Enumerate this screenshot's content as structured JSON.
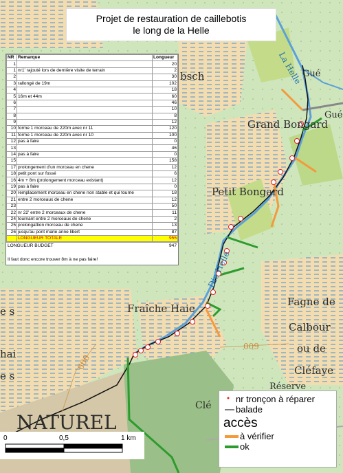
{
  "title": {
    "line1": "Projet de restauration de caillebotis",
    "line2": "le long de la Helle"
  },
  "table": {
    "headers": {
      "nr": "NR",
      "remark": "Remarque",
      "length": "Longueur"
    },
    "rows": [
      {
        "nr": "1",
        "remark": "",
        "length": "20"
      },
      {
        "nr": "1",
        "remark": "nr1' rajouté lors de dernière visite de terrain",
        "length": "2"
      },
      {
        "nr": "2",
        "remark": "",
        "length": "30"
      },
      {
        "nr": "3",
        "remark": "rallongé de 19m",
        "length": "102"
      },
      {
        "nr": "4",
        "remark": "",
        "length": "18"
      },
      {
        "nr": "5",
        "remark": "16m et 44m",
        "length": "60"
      },
      {
        "nr": "6",
        "remark": "",
        "length": "46"
      },
      {
        "nr": "7",
        "remark": "",
        "length": "10"
      },
      {
        "nr": "8",
        "remark": "",
        "length": "8"
      },
      {
        "nr": "9",
        "remark": "",
        "length": "12"
      },
      {
        "nr": "10",
        "remark": "forme 1 morceau de 220m avec nr 11",
        "length": "120"
      },
      {
        "nr": "11",
        "remark": "forme 1 morceau de 220m avec nr 10",
        "length": "100"
      },
      {
        "nr": "12",
        "remark": "pas à faire",
        "length": "0"
      },
      {
        "nr": "13",
        "remark": "",
        "length": "46"
      },
      {
        "nr": "14",
        "remark": "pas à faire",
        "length": "0"
      },
      {
        "nr": "15",
        "remark": "",
        "length": "158"
      },
      {
        "nr": "17",
        "remark": "prolongement d'un morceau en chene",
        "length": "12"
      },
      {
        "nr": "18",
        "remark": "petit pont sur fossé",
        "length": "6"
      },
      {
        "nr": "16",
        "remark": "4m + 8m (prolongement morceau existant)",
        "length": "12"
      },
      {
        "nr": "19",
        "remark": "pas à faire",
        "length": "0"
      },
      {
        "nr": "20",
        "remark": "remplacement morceau en chene non stable et qui tourne",
        "length": "18"
      },
      {
        "nr": "21",
        "remark": "entre 2 morceaux de chene",
        "length": "12"
      },
      {
        "nr": "23",
        "remark": "",
        "length": "50"
      },
      {
        "nr": "22",
        "remark": "nr 22' entre 2 morceaux de chene",
        "length": "11"
      },
      {
        "nr": "24",
        "remark": "tournant entre 2 morceaux de chene",
        "length": "2"
      },
      {
        "nr": "25",
        "remark": "prolongattion morceau de chene",
        "length": "13"
      },
      {
        "nr": "26",
        "remark": "jusqu'au pont marie anne libert",
        "length": "87"
      }
    ],
    "total_label": "LONGUEUR TOTALE",
    "total_value": "955",
    "budget_label": "LONGUEUR BUDGET",
    "budget_value": "947",
    "note": "Il faut donc encore trouver 8m à ne pas faire!"
  },
  "place_names": {
    "grand_bongard": "Grand Bongard",
    "petit_bongard": "Petit Bongard",
    "fraiche_haie": "Fraîche Haie",
    "fagne": "Fagne de",
    "calbour": "Calbour",
    "ou_de": "ou de",
    "clefaye": "Cléfaye",
    "naturel": "NATUREL",
    "reserve": "Réserve",
    "gue1": "Gué",
    "gue2": "Gué",
    "la_helle": "La Helle",
    "die_helle": "Die Helle",
    "cle": "Clé",
    "bsch": "bsch",
    "contour_600": "600",
    "contour_009": "009",
    "es1": "e s",
    "hai": "hai",
    "es2": "e s"
  },
  "legend": {
    "repair_label": "nr tronçon à réparer",
    "walk_label": "balade",
    "access_title": "accès",
    "check_label": "à vérifier",
    "ok_label": "ok",
    "colors": {
      "repair": "#e02020",
      "walk": "#000000",
      "check": "#f39a3c",
      "ok": "#2e9b2e"
    }
  },
  "scale": {
    "zero": "0",
    "half": "0,5",
    "one": "1 km"
  }
}
